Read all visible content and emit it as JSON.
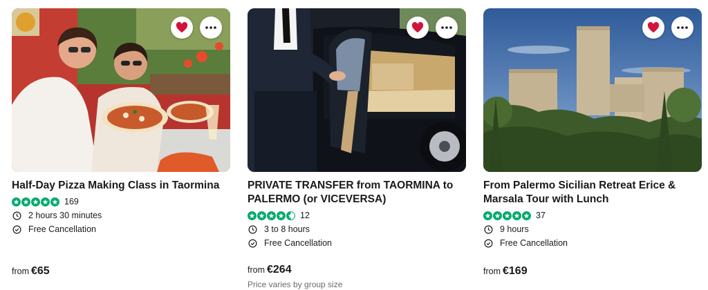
{
  "colors": {
    "rating_green": "#00aa6c",
    "heart_red": "#d2143a"
  },
  "cards": [
    {
      "title": "Half-Day Pizza Making Class in Taormina",
      "rating_stars": 5,
      "review_count": "169",
      "duration": "2 hours 30 minutes",
      "cancellation": "Free Cancellation",
      "price_prefix": "from",
      "price": "€65",
      "note": "",
      "image": "pizza-class-photo"
    },
    {
      "title": "PRIVATE TRANSFER from TAORMINA to PALERMO (or VICEVERSA)",
      "rating_stars": 4.5,
      "review_count": "12",
      "duration": "3 to 8 hours",
      "cancellation": "Free Cancellation",
      "price_prefix": "from",
      "price": "€264",
      "note": "Price varies by group size",
      "image": "private-car-photo"
    },
    {
      "title": "From Palermo Sicilian Retreat Erice & Marsala Tour with Lunch",
      "rating_stars": 5,
      "review_count": "37",
      "duration": "9 hours",
      "cancellation": "Free Cancellation",
      "price_prefix": "from",
      "price": "€169",
      "note": "",
      "image": "erice-castle-photo"
    }
  ]
}
